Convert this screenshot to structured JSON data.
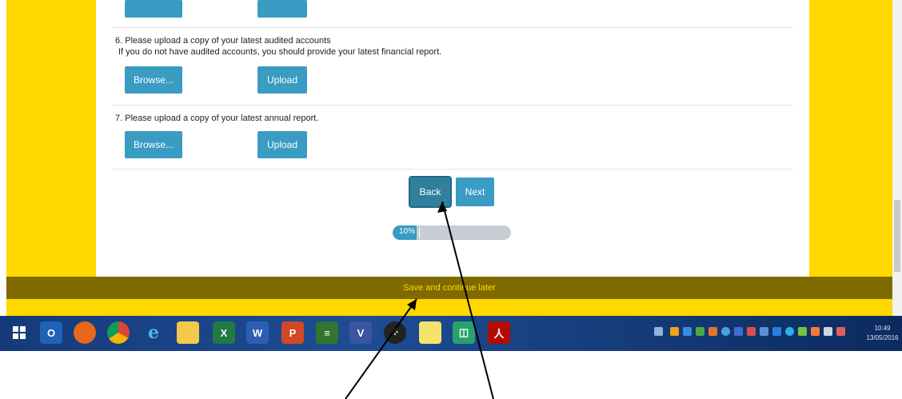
{
  "top_buttons": {
    "browse_label": "",
    "upload_label": ""
  },
  "questions": [
    {
      "number_text": "6. Please upload a copy of your latest audited accounts",
      "hint": "If you do not have audited accounts, you should provide your latest financial report.",
      "browse_label": "Browse...",
      "upload_label": "Upload"
    },
    {
      "number_text": "7. Please upload a copy of your latest annual report.",
      "browse_label": "Browse...",
      "upload_label": "Upload"
    }
  ],
  "nav": {
    "back_label": "Back",
    "next_label": "Next"
  },
  "progress": {
    "label": "10%",
    "value": 0.1
  },
  "footer": {
    "save_label": "Save and continue later"
  },
  "taskbar": {
    "apps": [
      "start-icon",
      "outlook-icon",
      "firefox-icon",
      "chrome-icon",
      "internet-explorer-icon",
      "file-explorer-icon",
      "excel-icon",
      "word-icon",
      "powerpoint-icon",
      "project-icon",
      "visio-icon",
      "blackberry-icon",
      "sticky-notes-icon",
      "cube-app-icon",
      "acrobat-icon"
    ],
    "clock_time": "10:49",
    "clock_date": "13/05/2016"
  },
  "colors": {
    "brand_yellow": "#ffd800",
    "save_bar": "#7f6a00",
    "button_blue": "#3a9cc2",
    "back_active": "#2f7f9d"
  }
}
